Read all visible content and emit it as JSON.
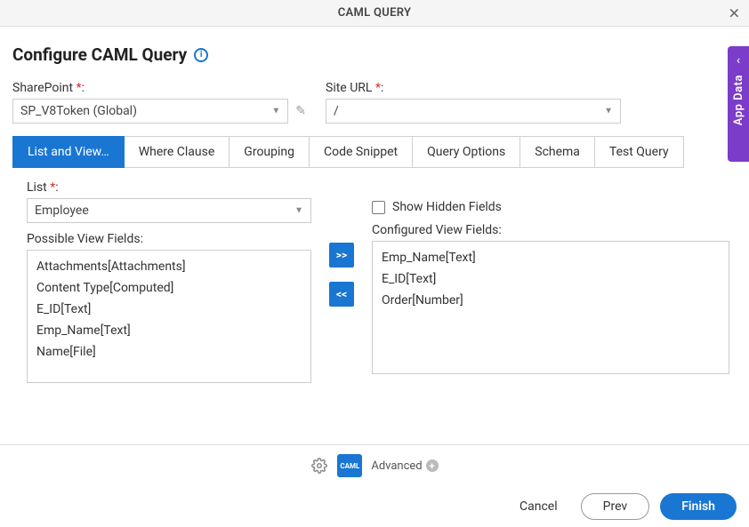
{
  "header": {
    "title": "CAML QUERY"
  },
  "page": {
    "title": "Configure CAML Query"
  },
  "sharepoint": {
    "label": "SharePoint",
    "value": "SP_V8Token (Global)"
  },
  "siteurl": {
    "label": "Site URL",
    "value": "/"
  },
  "tabs": [
    {
      "label": "List and View…",
      "active": true
    },
    {
      "label": "Where Clause"
    },
    {
      "label": "Grouping"
    },
    {
      "label": "Code Snippet"
    },
    {
      "label": "Query Options"
    },
    {
      "label": "Schema"
    },
    {
      "label": "Test Query"
    }
  ],
  "list": {
    "label": "List",
    "value": "Employee"
  },
  "showHidden": {
    "label": "Show Hidden Fields",
    "checked": false
  },
  "possible": {
    "label": "Possible View Fields:",
    "items": [
      "Attachments[Attachments]",
      "Content Type[Computed]",
      "E_ID[Text]",
      "Emp_Name[Text]",
      "Name[File]"
    ]
  },
  "configured": {
    "label": "Configured View Fields:",
    "items": [
      "Emp_Name[Text]",
      "E_ID[Text]",
      "Order[Number]"
    ]
  },
  "transfer": {
    "add": ">>",
    "remove": "<<"
  },
  "bottom": {
    "advanced": "Advanced",
    "camlText": "CAML"
  },
  "footer": {
    "cancel": "Cancel",
    "prev": "Prev",
    "finish": "Finish"
  },
  "sidetab": {
    "label": "App Data"
  }
}
